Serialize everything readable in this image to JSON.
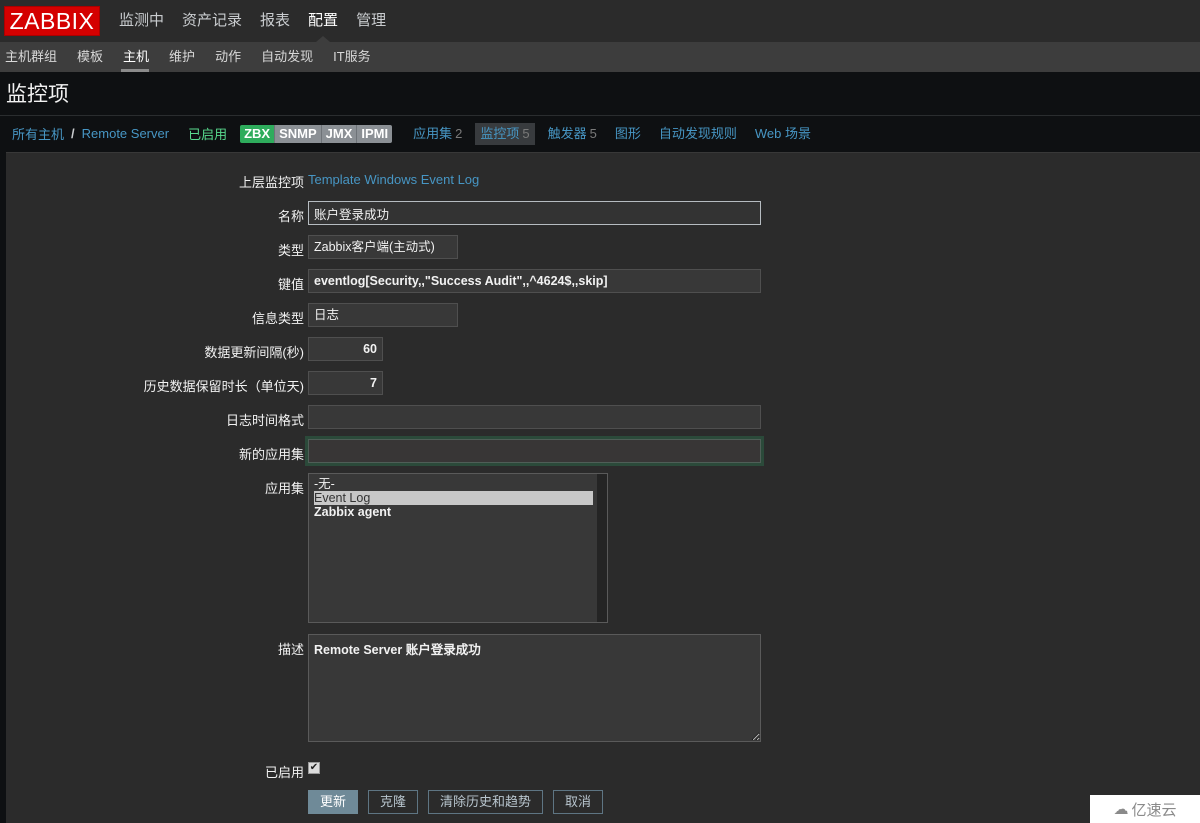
{
  "logo": "ZABBIX",
  "top_nav": [
    {
      "label": "监测中",
      "active": false
    },
    {
      "label": "资产记录",
      "active": false
    },
    {
      "label": "报表",
      "active": false
    },
    {
      "label": "配置",
      "active": true
    },
    {
      "label": "管理",
      "active": false
    }
  ],
  "sub_nav": [
    {
      "label": "主机群组",
      "active": false
    },
    {
      "label": "模板",
      "active": false
    },
    {
      "label": "主机",
      "active": true
    },
    {
      "label": "维护",
      "active": false
    },
    {
      "label": "动作",
      "active": false
    },
    {
      "label": "自动发现",
      "active": false
    },
    {
      "label": "IT服务",
      "active": false
    }
  ],
  "page_title": "监控项",
  "host_nav": {
    "all_hosts": "所有主机",
    "separator": "/",
    "host": "Remote Server",
    "status": "已启用",
    "badges": [
      {
        "label": "ZBX",
        "on": true
      },
      {
        "label": "SNMP",
        "on": false
      },
      {
        "label": "JMX",
        "on": false
      },
      {
        "label": "IPMI",
        "on": false
      }
    ],
    "tabs": [
      {
        "label": "应用集",
        "count": "2",
        "active": false
      },
      {
        "label": "监控项",
        "count": "5",
        "active": true
      },
      {
        "label": "触发器",
        "count": "5",
        "active": false
      },
      {
        "label": "图形",
        "count": "",
        "active": false
      },
      {
        "label": "自动发现规则",
        "count": "",
        "active": false
      },
      {
        "label": "Web 场景",
        "count": "",
        "active": false
      }
    ]
  },
  "form": {
    "parent_label": "上层监控项",
    "parent_value": "Template Windows Event Log",
    "name_label": "名称",
    "name_value": "账户登录成功",
    "type_label": "类型",
    "type_value": "Zabbix客户端(主动式)",
    "key_label": "键值",
    "key_value": "eventlog[Security,,\"Success Audit\",,^4624$,,skip]",
    "info_type_label": "信息类型",
    "info_type_value": "日志",
    "interval_label": "数据更新间隔(秒)",
    "interval_value": "60",
    "history_label": "历史数据保留时长（单位天)",
    "history_value": "7",
    "log_format_label": "日志时间格式",
    "log_format_value": "",
    "new_app_label": "新的应用集",
    "new_app_value": "",
    "apps_label": "应用集",
    "apps_options": [
      {
        "label": "-无-",
        "selected": false
      },
      {
        "label": "Event Log",
        "selected": true
      },
      {
        "label": "Zabbix agent",
        "selected": false
      }
    ],
    "desc_label": "描述",
    "desc_value": "Remote Server 账户登录成功",
    "enabled_label": "已启用",
    "enabled_checked": true
  },
  "buttons": {
    "update": "更新",
    "clone": "克隆",
    "clear_history": "清除历史和趋势",
    "cancel": "取消"
  },
  "watermark": "亿速云"
}
